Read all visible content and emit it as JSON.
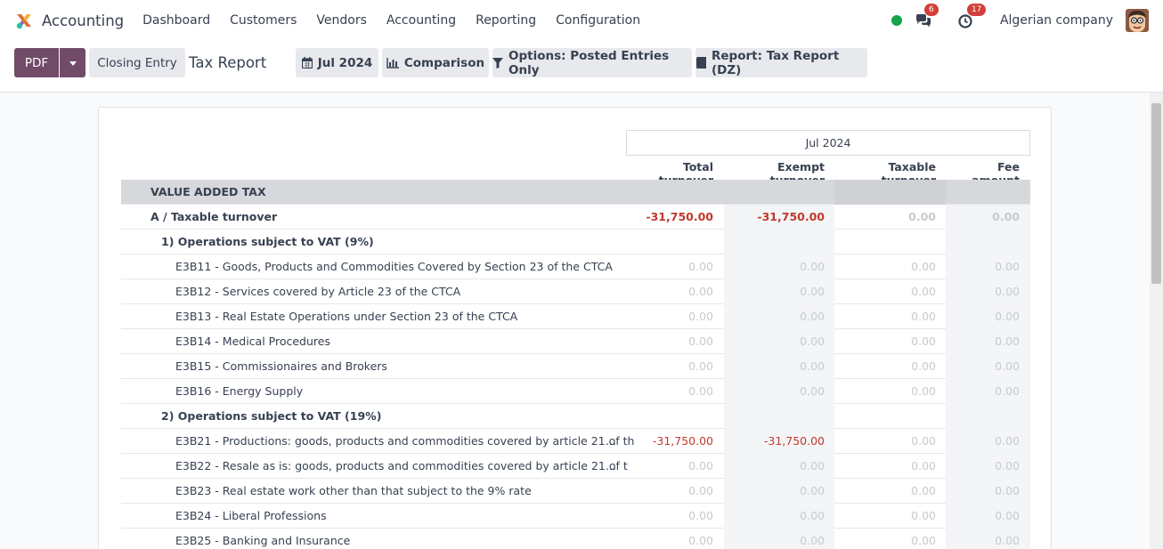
{
  "navbar": {
    "brand": "Accounting",
    "menu": [
      "Dashboard",
      "Customers",
      "Vendors",
      "Accounting",
      "Reporting",
      "Configuration"
    ],
    "messages_count": "6",
    "activities_count": "17",
    "company": "Algerian company"
  },
  "control_panel": {
    "pdf_label": "PDF",
    "closing_entry_label": "Closing Entry",
    "title": "Tax Report",
    "filters": {
      "date": "Jul 2024",
      "comparison": "Comparison",
      "options": "Options: Posted Entries Only",
      "report": "Report: Tax Report (DZ)"
    }
  },
  "report": {
    "period": "Jul 2024",
    "columns": [
      "Total turnover",
      "Exempt turnover",
      "Taxable turnover",
      "Fee amount"
    ],
    "rows": [
      {
        "label": "VALUE ADDED TAX",
        "level": "section",
        "values": [
          "",
          "",
          "",
          ""
        ]
      },
      {
        "label": "A / Taxable turnover",
        "level": "total",
        "values": [
          "-31,750.00",
          "-31,750.00",
          "0.00",
          "0.00"
        ]
      },
      {
        "label": "1) Operations subject to VAT (9%)",
        "level": "group",
        "values": [
          "",
          "",
          "",
          ""
        ]
      },
      {
        "label": "E3B11 - Goods, Products and Commodities Covered by Section 23 of the CTCA",
        "level": "line",
        "values": [
          "0.00",
          "0.00",
          "0.00",
          "0.00"
        ]
      },
      {
        "label": "E3B12 - Services covered by Article 23 of the CTCA",
        "level": "line",
        "values": [
          "0.00",
          "0.00",
          "0.00",
          "0.00"
        ]
      },
      {
        "label": "E3B13 - Real Estate Operations under Section 23 of the CTCA",
        "level": "line",
        "values": [
          "0.00",
          "0.00",
          "0.00",
          "0.00"
        ]
      },
      {
        "label": "E3B14 - Medical Procedures",
        "level": "line",
        "values": [
          "0.00",
          "0.00",
          "0.00",
          "0.00"
        ]
      },
      {
        "label": "E3B15 - Commissionaires and Brokers",
        "level": "line",
        "values": [
          "0.00",
          "0.00",
          "0.00",
          "0.00"
        ]
      },
      {
        "label": "E3B16 - Energy Supply",
        "level": "line",
        "values": [
          "0.00",
          "0.00",
          "0.00",
          "0.00"
        ]
      },
      {
        "label": "2) Operations subject to VAT (19%)",
        "level": "group",
        "values": [
          "",
          "",
          "",
          ""
        ]
      },
      {
        "label": "E3B21 - Productions: goods, products and commodities covered by article 21 of th",
        "level": "line",
        "truncated": true,
        "values": [
          "-31,750.00",
          "-31,750.00",
          "0.00",
          "0.00"
        ]
      },
      {
        "label": "E3B22 - Resale as is: goods, products and commodities covered by article 21 of t",
        "level": "line",
        "truncated": true,
        "values": [
          "0.00",
          "0.00",
          "0.00",
          "0.00"
        ]
      },
      {
        "label": "E3B23 - Real estate work other than that subject to the 9% rate",
        "level": "line",
        "values": [
          "0.00",
          "0.00",
          "0.00",
          "0.00"
        ]
      },
      {
        "label": "E3B24 - Liberal Professions",
        "level": "line",
        "values": [
          "0.00",
          "0.00",
          "0.00",
          "0.00"
        ]
      },
      {
        "label": "E3B25 - Banking and Insurance",
        "level": "line",
        "values": [
          "0.00",
          "0.00",
          "0.00",
          "0.00"
        ]
      }
    ]
  },
  "ellipsis": "..."
}
